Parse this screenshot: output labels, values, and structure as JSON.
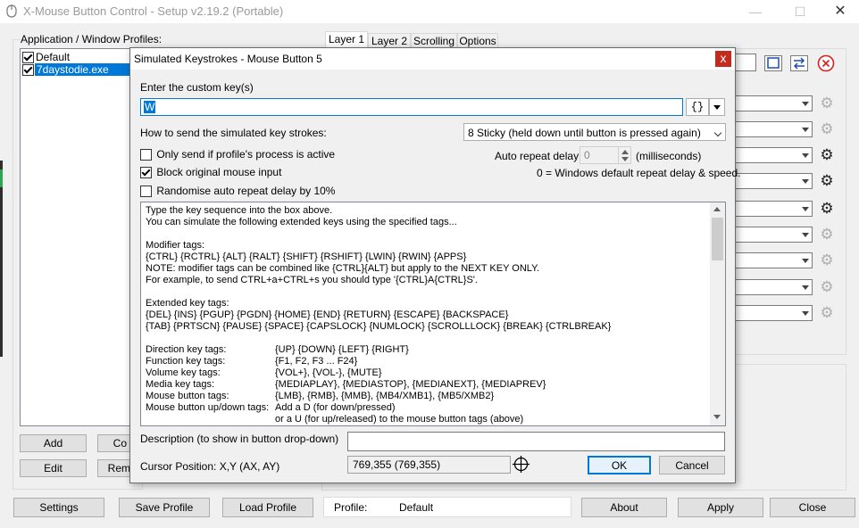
{
  "window": {
    "title": "X-Mouse Button Control - Setup v2.19.2 (Portable)",
    "minimize": "—",
    "maximize": "☐",
    "close": "✕"
  },
  "profiles": {
    "label": "Application / Window Profiles:",
    "items": [
      {
        "name": "Default",
        "checked": true,
        "selected": false
      },
      {
        "name": "7daystodie.exe",
        "checked": true,
        "selected": true
      }
    ],
    "add": "Add",
    "copy": "Co",
    "edit": "Edit",
    "remove": "Rem"
  },
  "tabs": [
    "Layer 1",
    "Layer 2",
    "Scrolling",
    "Options"
  ],
  "bottom": {
    "settings": "Settings",
    "save_profile": "Save Profile",
    "load_profile": "Load Profile",
    "profile_label": "Profile:",
    "profile_value": "Default",
    "about": "About",
    "apply": "Apply",
    "close": "Close"
  },
  "dialog": {
    "title": "Simulated Keystrokes - Mouse Button 5",
    "close": "x",
    "custom_key_label": "Enter the custom key(s)",
    "custom_key_value": "W",
    "tags_button": "{}",
    "how_to_send_label": "How to send the simulated key strokes:",
    "send_mode": "8 Sticky (held down until button is pressed again)",
    "only_send_label": "Only send if profile's process is active",
    "only_send_checked": false,
    "block_label": "Block original mouse input",
    "block_checked": true,
    "randomise_label": "Randomise auto repeat delay by 10%",
    "randomise_checked": false,
    "repeat_delay_label": "Auto repeat delay",
    "repeat_delay_value": "0",
    "repeat_delay_unit": "(milliseconds)",
    "repeat_delay_note": "0 = Windows default repeat delay & speed.",
    "help_lines": [
      "Type the key sequence into the box above.",
      "You can simulate the following extended keys using the specified tags...",
      "",
      "Modifier tags:",
      "  {CTRL} {RCTRL} {ALT} {RALT} {SHIFT} {RSHIFT} {LWIN} {RWIN} {APPS}",
      "  NOTE:    modifier tags can be combined like {CTRL}{ALT} but apply to the NEXT KEY ONLY.",
      "                For example, to send CTRL+a+CTRL+s you should type '{CTRL}A{CTRL}S'.",
      "",
      "Extended key tags:",
      "  {DEL} {INS} {PGUP} {PGDN} {HOME} {END} {RETURN} {ESCAPE} {BACKSPACE}",
      "  {TAB} {PRTSCN} {PAUSE} {SPACE} {CAPSLOCK} {NUMLOCK} {SCROLLLOCK} {BREAK} {CTRLBREAK}",
      ""
    ],
    "help_table": [
      {
        "k": "Direction key tags:",
        "v": "{UP} {DOWN} {LEFT} {RIGHT}"
      },
      {
        "k": "Function key tags:",
        "v": "{F1, F2, F3 ... F24}"
      },
      {
        "k": "Volume key tags:",
        "v": "{VOL+}, {VOL-}, {MUTE}"
      },
      {
        "k": "Media key tags:",
        "v": "{MEDIAPLAY}, {MEDIASTOP}, {MEDIANEXT}, {MEDIAPREV}"
      },
      {
        "k": "Mouse button tags:",
        "v": "{LMB}, {RMB}, {MMB}, {MB4/XMB1}, {MB5/XMB2}"
      },
      {
        "k": "Mouse button up/down tags:",
        "v": "Add a D (for down/pressed)"
      },
      {
        "k": "",
        "v": "or a U (for up/released) to the mouse button tags (above)"
      }
    ],
    "description_label": "Description (to show in button drop-down)",
    "description_value": "",
    "cursor_label": "Cursor Position: X,Y (AX, AY)",
    "cursor_value": "769,355 (769,355)",
    "ok": "OK",
    "cancel": "Cancel"
  }
}
